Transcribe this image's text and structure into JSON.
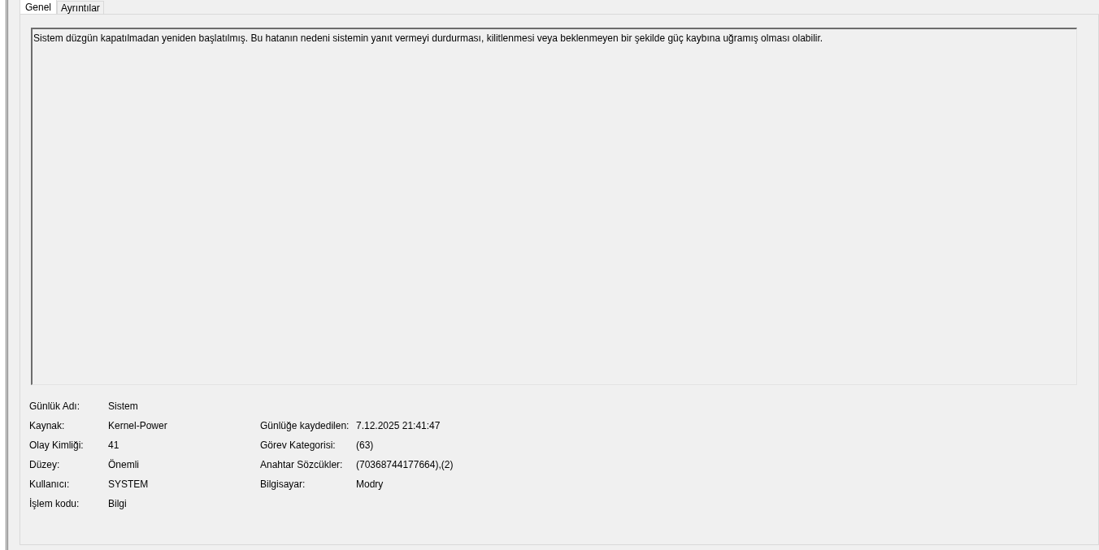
{
  "tabs": [
    {
      "label": "Genel",
      "selected": true
    },
    {
      "label": "Ayrıntılar",
      "selected": false
    }
  ],
  "description": "Sistem düzgün kapatılmadan yeniden başlatılmış. Bu hatanın nedeni sistemin yanıt vermeyi durdurması, kilitlenmesi veya beklenmeyen bir şekilde güç kaybına uğramış olması olabilir.",
  "rows": [
    {
      "left": {
        "label": "Günlük Adı:",
        "value": "Sistem"
      }
    },
    {
      "left": {
        "label": "Kaynak:",
        "value": "Kernel-Power"
      },
      "right": {
        "label": "Günlüğe kaydedilen:",
        "value": "7.12.2025 21:41:47"
      }
    },
    {
      "left": {
        "label": "Olay Kimliği:",
        "value": "41"
      },
      "right": {
        "label": "Görev Kategorisi:",
        "value": "(63)"
      }
    },
    {
      "left": {
        "label": "Düzey:",
        "value": "Önemli"
      },
      "right": {
        "label": "Anahtar Sözcükler:",
        "value": "(70368744177664),(2)"
      }
    },
    {
      "left": {
        "label": "Kullanıcı:",
        "value": "SYSTEM"
      },
      "right": {
        "label": "Bilgisayar:",
        "value": "Modry"
      }
    },
    {
      "left": {
        "label": "İşlem kodu:",
        "value": "Bilgi"
      }
    }
  ]
}
